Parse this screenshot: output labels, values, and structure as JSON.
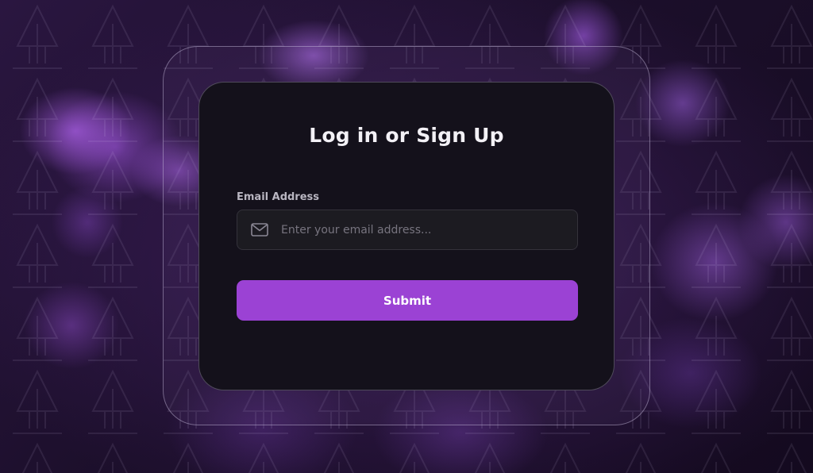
{
  "login_card": {
    "title": "Log in or Sign Up",
    "email_label": "Email Address",
    "email_value": "",
    "email_placeholder": "Enter your email address...",
    "email_icon": "mail-icon",
    "submit_label": "Submit"
  },
  "colors": {
    "accent": "#9b42d4",
    "card_background": "#14111b",
    "input_background": "#1c1b21",
    "page_background": "#1c0f2b"
  }
}
